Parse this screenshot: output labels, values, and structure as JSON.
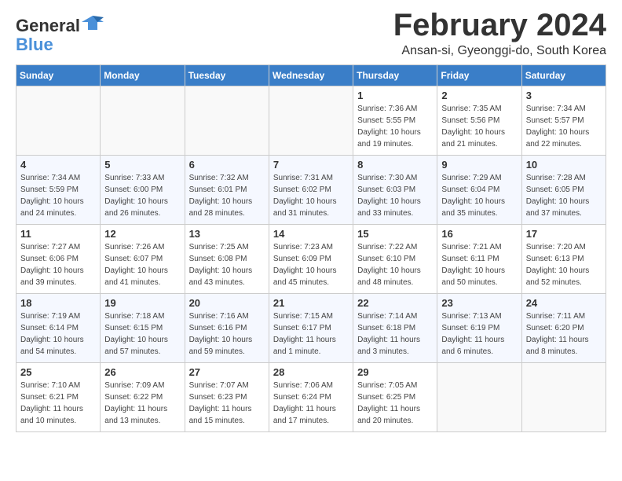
{
  "logo": {
    "line1": "General",
    "line2": "Blue"
  },
  "title": "February 2024",
  "location": "Ansan-si, Gyeonggi-do, South Korea",
  "headers": [
    "Sunday",
    "Monday",
    "Tuesday",
    "Wednesday",
    "Thursday",
    "Friday",
    "Saturday"
  ],
  "weeks": [
    [
      {
        "day": "",
        "info": ""
      },
      {
        "day": "",
        "info": ""
      },
      {
        "day": "",
        "info": ""
      },
      {
        "day": "",
        "info": ""
      },
      {
        "day": "1",
        "info": "Sunrise: 7:36 AM\nSunset: 5:55 PM\nDaylight: 10 hours\nand 19 minutes."
      },
      {
        "day": "2",
        "info": "Sunrise: 7:35 AM\nSunset: 5:56 PM\nDaylight: 10 hours\nand 21 minutes."
      },
      {
        "day": "3",
        "info": "Sunrise: 7:34 AM\nSunset: 5:57 PM\nDaylight: 10 hours\nand 22 minutes."
      }
    ],
    [
      {
        "day": "4",
        "info": "Sunrise: 7:34 AM\nSunset: 5:59 PM\nDaylight: 10 hours\nand 24 minutes."
      },
      {
        "day": "5",
        "info": "Sunrise: 7:33 AM\nSunset: 6:00 PM\nDaylight: 10 hours\nand 26 minutes."
      },
      {
        "day": "6",
        "info": "Sunrise: 7:32 AM\nSunset: 6:01 PM\nDaylight: 10 hours\nand 28 minutes."
      },
      {
        "day": "7",
        "info": "Sunrise: 7:31 AM\nSunset: 6:02 PM\nDaylight: 10 hours\nand 31 minutes."
      },
      {
        "day": "8",
        "info": "Sunrise: 7:30 AM\nSunset: 6:03 PM\nDaylight: 10 hours\nand 33 minutes."
      },
      {
        "day": "9",
        "info": "Sunrise: 7:29 AM\nSunset: 6:04 PM\nDaylight: 10 hours\nand 35 minutes."
      },
      {
        "day": "10",
        "info": "Sunrise: 7:28 AM\nSunset: 6:05 PM\nDaylight: 10 hours\nand 37 minutes."
      }
    ],
    [
      {
        "day": "11",
        "info": "Sunrise: 7:27 AM\nSunset: 6:06 PM\nDaylight: 10 hours\nand 39 minutes."
      },
      {
        "day": "12",
        "info": "Sunrise: 7:26 AM\nSunset: 6:07 PM\nDaylight: 10 hours\nand 41 minutes."
      },
      {
        "day": "13",
        "info": "Sunrise: 7:25 AM\nSunset: 6:08 PM\nDaylight: 10 hours\nand 43 minutes."
      },
      {
        "day": "14",
        "info": "Sunrise: 7:23 AM\nSunset: 6:09 PM\nDaylight: 10 hours\nand 45 minutes."
      },
      {
        "day": "15",
        "info": "Sunrise: 7:22 AM\nSunset: 6:10 PM\nDaylight: 10 hours\nand 48 minutes."
      },
      {
        "day": "16",
        "info": "Sunrise: 7:21 AM\nSunset: 6:11 PM\nDaylight: 10 hours\nand 50 minutes."
      },
      {
        "day": "17",
        "info": "Sunrise: 7:20 AM\nSunset: 6:13 PM\nDaylight: 10 hours\nand 52 minutes."
      }
    ],
    [
      {
        "day": "18",
        "info": "Sunrise: 7:19 AM\nSunset: 6:14 PM\nDaylight: 10 hours\nand 54 minutes."
      },
      {
        "day": "19",
        "info": "Sunrise: 7:18 AM\nSunset: 6:15 PM\nDaylight: 10 hours\nand 57 minutes."
      },
      {
        "day": "20",
        "info": "Sunrise: 7:16 AM\nSunset: 6:16 PM\nDaylight: 10 hours\nand 59 minutes."
      },
      {
        "day": "21",
        "info": "Sunrise: 7:15 AM\nSunset: 6:17 PM\nDaylight: 11 hours\nand 1 minute."
      },
      {
        "day": "22",
        "info": "Sunrise: 7:14 AM\nSunset: 6:18 PM\nDaylight: 11 hours\nand 3 minutes."
      },
      {
        "day": "23",
        "info": "Sunrise: 7:13 AM\nSunset: 6:19 PM\nDaylight: 11 hours\nand 6 minutes."
      },
      {
        "day": "24",
        "info": "Sunrise: 7:11 AM\nSunset: 6:20 PM\nDaylight: 11 hours\nand 8 minutes."
      }
    ],
    [
      {
        "day": "25",
        "info": "Sunrise: 7:10 AM\nSunset: 6:21 PM\nDaylight: 11 hours\nand 10 minutes."
      },
      {
        "day": "26",
        "info": "Sunrise: 7:09 AM\nSunset: 6:22 PM\nDaylight: 11 hours\nand 13 minutes."
      },
      {
        "day": "27",
        "info": "Sunrise: 7:07 AM\nSunset: 6:23 PM\nDaylight: 11 hours\nand 15 minutes."
      },
      {
        "day": "28",
        "info": "Sunrise: 7:06 AM\nSunset: 6:24 PM\nDaylight: 11 hours\nand 17 minutes."
      },
      {
        "day": "29",
        "info": "Sunrise: 7:05 AM\nSunset: 6:25 PM\nDaylight: 11 hours\nand 20 minutes."
      },
      {
        "day": "",
        "info": ""
      },
      {
        "day": "",
        "info": ""
      }
    ]
  ]
}
